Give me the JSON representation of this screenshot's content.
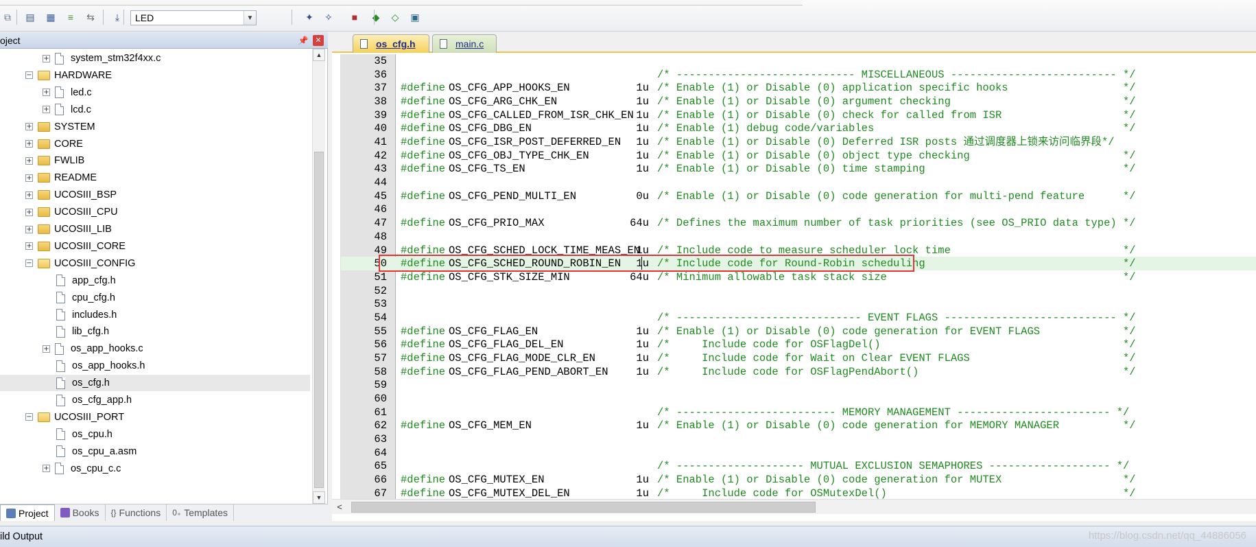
{
  "toolbar": {
    "target_value": "LED",
    "icons": [
      "copy-icon",
      "batch-build-icon",
      "rebuild-icon",
      "stack-icon",
      "translate-icon",
      "load-icon",
      "target-options-icon",
      "magic-wand-icon",
      "manage-components-icon",
      "pack-installer-icon",
      "select-packs-icon",
      "run-env-icon"
    ]
  },
  "project_pane": {
    "title": "oject",
    "tree": [
      {
        "label": "system_stm32f4xx.c",
        "type": "file",
        "level": 2,
        "expander": "+"
      },
      {
        "label": "HARDWARE",
        "type": "folder-open",
        "level": 1,
        "expander": "-"
      },
      {
        "label": "led.c",
        "type": "file",
        "level": 2,
        "expander": "+"
      },
      {
        "label": "lcd.c",
        "type": "file",
        "level": 2,
        "expander": "+"
      },
      {
        "label": "SYSTEM",
        "type": "folder",
        "level": 1,
        "expander": "+"
      },
      {
        "label": "CORE",
        "type": "folder",
        "level": 1,
        "expander": "+"
      },
      {
        "label": "FWLIB",
        "type": "folder",
        "level": 1,
        "expander": "+"
      },
      {
        "label": "README",
        "type": "folder",
        "level": 1,
        "expander": "+"
      },
      {
        "label": "UCOSIII_BSP",
        "type": "folder",
        "level": 1,
        "expander": "+"
      },
      {
        "label": "UCOSIII_CPU",
        "type": "folder",
        "level": 1,
        "expander": "+"
      },
      {
        "label": "UCOSIII_LIB",
        "type": "folder",
        "level": 1,
        "expander": "+"
      },
      {
        "label": "UCOSIII_CORE",
        "type": "folder",
        "level": 1,
        "expander": "+"
      },
      {
        "label": "UCOSIII_CONFIG",
        "type": "folder-open",
        "level": 1,
        "expander": "-"
      },
      {
        "label": "app_cfg.h",
        "type": "file",
        "level": 2,
        "expander": ""
      },
      {
        "label": "cpu_cfg.h",
        "type": "file",
        "level": 2,
        "expander": ""
      },
      {
        "label": "includes.h",
        "type": "file",
        "level": 2,
        "expander": ""
      },
      {
        "label": "lib_cfg.h",
        "type": "file",
        "level": 2,
        "expander": ""
      },
      {
        "label": "os_app_hooks.c",
        "type": "file",
        "level": 2,
        "expander": "+"
      },
      {
        "label": "os_app_hooks.h",
        "type": "file",
        "level": 2,
        "expander": ""
      },
      {
        "label": "os_cfg.h",
        "type": "file",
        "level": 2,
        "expander": "",
        "selected": true
      },
      {
        "label": "os_cfg_app.h",
        "type": "file",
        "level": 2,
        "expander": ""
      },
      {
        "label": "UCOSIII_PORT",
        "type": "folder-open",
        "level": 1,
        "expander": "-"
      },
      {
        "label": "os_cpu.h",
        "type": "file",
        "level": 2,
        "expander": ""
      },
      {
        "label": "os_cpu_a.asm",
        "type": "file",
        "level": 2,
        "expander": ""
      },
      {
        "label": "os_cpu_c.c",
        "type": "file",
        "level": 2,
        "expander": "+"
      }
    ],
    "tabs": [
      {
        "label": "Project",
        "active": true,
        "icon": "project-icon"
      },
      {
        "label": "Books",
        "active": false,
        "icon": "books-icon"
      },
      {
        "label": "Functions",
        "active": false,
        "icon": "functions-icon"
      },
      {
        "label": "Templates",
        "active": false,
        "icon": "templates-icon"
      }
    ]
  },
  "editor": {
    "tabs": [
      {
        "label": "os_cfg.h",
        "active": true
      },
      {
        "label": "main.c",
        "active": false
      }
    ],
    "highlighted_line": 50,
    "lines": [
      {
        "n": "35",
        "define": "",
        "name": "",
        "value": "",
        "comment": ""
      },
      {
        "n": "36",
        "define": "",
        "name": "",
        "value": "",
        "comment": "/* ---------------------------- MISCELLANEOUS -------------------------- */"
      },
      {
        "n": "37",
        "define": "#define",
        "name": "OS_CFG_APP_HOOKS_EN",
        "value": "1u",
        "comment": "/* Enable (1) or Disable (0) application specific hooks                  */"
      },
      {
        "n": "38",
        "define": "#define",
        "name": "OS_CFG_ARG_CHK_EN",
        "value": "1u",
        "comment": "/* Enable (1) or Disable (0) argument checking                           */"
      },
      {
        "n": "39",
        "define": "#define",
        "name": "OS_CFG_CALLED_FROM_ISR_CHK_EN",
        "value": "1u",
        "comment": "/* Enable (1) or Disable (0) check for called from ISR                   */"
      },
      {
        "n": "40",
        "define": "#define",
        "name": "OS_CFG_DBG_EN",
        "value": "1u",
        "comment": "/* Enable (1) debug code/variables                                       */"
      },
      {
        "n": "41",
        "define": "#define",
        "name": "OS_CFG_ISR_POST_DEFERRED_EN",
        "value": "1u",
        "comment": "/* Enable (1) or Disable (0) Deferred ISR posts 通过调度器上锁来访问临界段*/"
      },
      {
        "n": "42",
        "define": "#define",
        "name": "OS_CFG_OBJ_TYPE_CHK_EN",
        "value": "1u",
        "comment": "/* Enable (1) or Disable (0) object type checking                        */"
      },
      {
        "n": "43",
        "define": "#define",
        "name": "OS_CFG_TS_EN",
        "value": "1u",
        "comment": "/* Enable (1) or Disable (0) time stamping                               */"
      },
      {
        "n": "44",
        "define": "",
        "name": "",
        "value": "",
        "comment": ""
      },
      {
        "n": "45",
        "define": "#define",
        "name": "OS_CFG_PEND_MULTI_EN",
        "value": "0u",
        "comment": "/* Enable (1) or Disable (0) code generation for multi-pend feature      */"
      },
      {
        "n": "46",
        "define": "",
        "name": "",
        "value": "",
        "comment": ""
      },
      {
        "n": "47",
        "define": "#define",
        "name": "OS_CFG_PRIO_MAX",
        "value": "64u",
        "comment": "/* Defines the maximum number of task priorities (see OS_PRIO data type) */"
      },
      {
        "n": "48",
        "define": "",
        "name": "",
        "value": "",
        "comment": ""
      },
      {
        "n": "49",
        "define": "#define",
        "name": "OS_CFG_SCHED_LOCK_TIME_MEAS_EN",
        "value": "1u",
        "comment": "/* Include code to measure scheduler lock time                           */"
      },
      {
        "n": "50",
        "define": "#define",
        "name": "OS_CFG_SCHED_ROUND_ROBIN_EN",
        "value": "1u",
        "comment": "/* Include code for Round-Robin scheduling                               */"
      },
      {
        "n": "51",
        "define": "#define",
        "name": "OS_CFG_STK_SIZE_MIN",
        "value": "64u",
        "comment": "/* Minimum allowable task stack size                                     */"
      },
      {
        "n": "52",
        "define": "",
        "name": "",
        "value": "",
        "comment": ""
      },
      {
        "n": "53",
        "define": "",
        "name": "",
        "value": "",
        "comment": ""
      },
      {
        "n": "54",
        "define": "",
        "name": "",
        "value": "",
        "comment": "/* ----------------------------- EVENT FLAGS --------------------------- */"
      },
      {
        "n": "55",
        "define": "#define",
        "name": "OS_CFG_FLAG_EN",
        "value": "1u",
        "comment": "/* Enable (1) or Disable (0) code generation for EVENT FLAGS             */"
      },
      {
        "n": "56",
        "define": "#define",
        "name": "OS_CFG_FLAG_DEL_EN",
        "value": "1u",
        "comment": "/*     Include code for OSFlagDel()                                      */"
      },
      {
        "n": "57",
        "define": "#define",
        "name": "OS_CFG_FLAG_MODE_CLR_EN",
        "value": "1u",
        "comment": "/*     Include code for Wait on Clear EVENT FLAGS                        */"
      },
      {
        "n": "58",
        "define": "#define",
        "name": "OS_CFG_FLAG_PEND_ABORT_EN",
        "value": "1u",
        "comment": "/*     Include code for OSFlagPendAbort()                                */"
      },
      {
        "n": "59",
        "define": "",
        "name": "",
        "value": "",
        "comment": ""
      },
      {
        "n": "60",
        "define": "",
        "name": "",
        "value": "",
        "comment": ""
      },
      {
        "n": "61",
        "define": "",
        "name": "",
        "value": "",
        "comment": "/* ------------------------- MEMORY MANAGEMENT ------------------------ */"
      },
      {
        "n": "62",
        "define": "#define",
        "name": "OS_CFG_MEM_EN",
        "value": "1u",
        "comment": "/* Enable (1) or Disable (0) code generation for MEMORY MANAGER          */"
      },
      {
        "n": "63",
        "define": "",
        "name": "",
        "value": "",
        "comment": ""
      },
      {
        "n": "64",
        "define": "",
        "name": "",
        "value": "",
        "comment": ""
      },
      {
        "n": "65",
        "define": "",
        "name": "",
        "value": "",
        "comment": "/* -------------------- MUTUAL EXCLUSION SEMAPHORES ------------------- */"
      },
      {
        "n": "66",
        "define": "#define",
        "name": "OS_CFG_MUTEX_EN",
        "value": "1u",
        "comment": "/* Enable (1) or Disable (0) code generation for MUTEX                   */"
      },
      {
        "n": "67",
        "define": "#define",
        "name": "OS_CFG_MUTEX_DEL_EN",
        "value": "1u",
        "comment": "/*     Include code for OSMutexDel()                                     */"
      }
    ]
  },
  "build_output": {
    "title": "ild Output"
  },
  "watermark": "https://blog.csdn.net/qq_44886056",
  "colors": {
    "keyword": "#1e8b1e",
    "highlight_box": "#e53333",
    "highlight_line": "#e5f5e5",
    "active_tab": "#f5cf5a"
  }
}
